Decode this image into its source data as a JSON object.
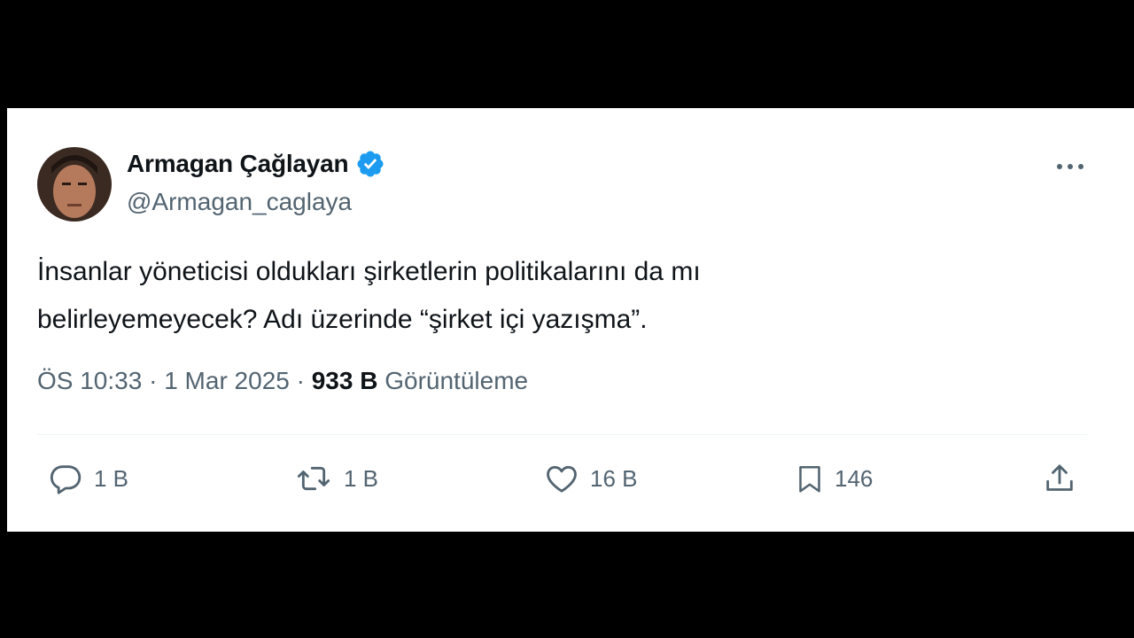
{
  "author": {
    "name": "Armagan Çağlayan",
    "handle": "@Armagan_caglaya",
    "verified": true
  },
  "tweet": {
    "lines": [
      "İnsanlar yöneticisi oldukları şirketlerin politikalarını da mı",
      "belirleyemeyecek? Adı üzerinde “şirket içi yazışma”."
    ],
    "time": "ÖS 10:33",
    "separator": "·",
    "date": "1 Mar 2025",
    "views_count": "933 B",
    "views_label": "Görüntüleme"
  },
  "actions": {
    "replies": "1 B",
    "retweets": "1 B",
    "likes": "16 B",
    "bookmarks": "146"
  },
  "colors": {
    "text_primary": "#0f1419",
    "text_secondary": "#536471",
    "verified_blue": "#1d9bf0",
    "divider": "#eff3f4",
    "letterbox": "#000000"
  },
  "icons": [
    "verified-badge-icon",
    "more-icon",
    "reply-icon",
    "retweet-icon",
    "like-icon",
    "bookmark-icon",
    "share-icon"
  ]
}
